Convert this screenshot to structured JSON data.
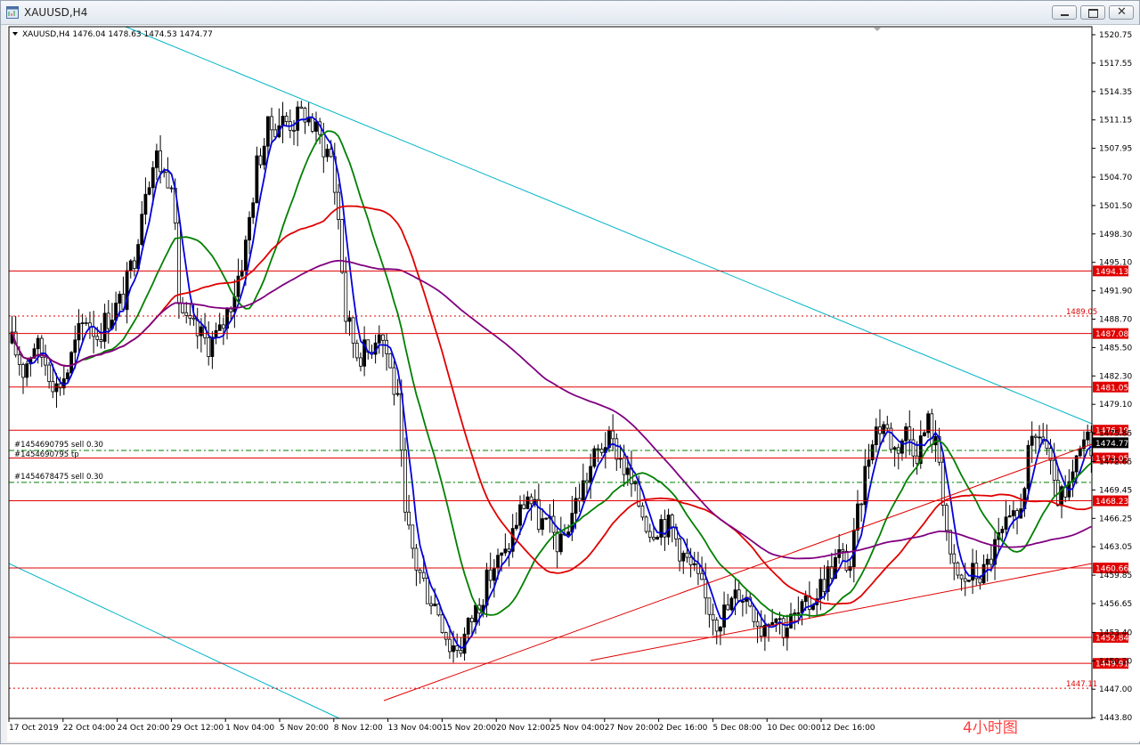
{
  "window": {
    "title": "XAUUSD,H4",
    "icon": "chart-window-icon",
    "buttons": [
      "minimize-icon",
      "restore-icon",
      "close-icon"
    ]
  },
  "chart_header": "XAUUSD,H4  1476.04 1478.63 1474.53 1474.77",
  "watermark": "4小时图",
  "price_axis": [
    "1520.75",
    "1517.55",
    "1514.35",
    "1511.15",
    "1507.95",
    "1504.70",
    "1501.50",
    "1498.30",
    "1495.10",
    "1491.90",
    "1488.70",
    "1485.50",
    "1482.30",
    "1479.10",
    "1475.85",
    "1472.65",
    "1469.45",
    "1466.25",
    "1463.05",
    "1459.85",
    "1456.65",
    "1453.40",
    "1450.20",
    "1447.00",
    "1443.80"
  ],
  "time_axis": [
    "17 Oct 2019",
    "22 Oct 04:00",
    "24 Oct 20:00",
    "29 Oct 12:00",
    "1 Nov 04:00",
    "5 Nov 20:00",
    "8 Nov 12:00",
    "13 Nov 04:00",
    "15 Nov 20:00",
    "20 Nov 12:00",
    "25 Nov 04:00",
    "27 Nov 20:00",
    "2 Dec 16:00",
    "5 Dec 08:00",
    "10 Dec 00:00",
    "12 Dec 16:00"
  ],
  "price_levels": [
    {
      "label": "1494.13",
      "style": "solid-box"
    },
    {
      "label": "1489.05",
      "style": "dotted-text"
    },
    {
      "label": "1487.08",
      "style": "solid-box"
    },
    {
      "label": "1481.05",
      "style": "solid-box"
    },
    {
      "label": "1476.19",
      "style": "solid-box"
    },
    {
      "label": "1473.05",
      "style": "solid-box"
    },
    {
      "label": "1468.23",
      "style": "solid-box"
    },
    {
      "label": "1460.66",
      "style": "solid-box"
    },
    {
      "label": "1452.84",
      "style": "solid-box"
    },
    {
      "label": "1449.91",
      "style": "solid-box"
    },
    {
      "label": "1447.11",
      "style": "dotted-text"
    }
  ],
  "current_price": "1474.77",
  "orders": [
    {
      "label": "#1454690795 sell 0.30"
    },
    {
      "label": "#1454690795 tp"
    },
    {
      "label": "#1454678475 sell 0.30"
    }
  ],
  "colors": {
    "up_candle": "#000000",
    "down_candle": "#ffffff",
    "ma_blue": "#0000dd",
    "ma_green": "#008000",
    "ma_red": "#e00000",
    "ma_purple": "#800080",
    "trendline_cyan": "#00b4c8",
    "level_red": "#e00000",
    "order_green": "#008000"
  },
  "chart_data": {
    "type": "candlestick",
    "symbol": "XAUUSD",
    "timeframe": "H4",
    "ylim": [
      1443.8,
      1522.0
    ],
    "anchors": [
      [
        0,
        1486
      ],
      [
        3,
        1483
      ],
      [
        6,
        1486
      ],
      [
        9,
        1484
      ],
      [
        12,
        1481
      ],
      [
        15,
        1483
      ],
      [
        18,
        1487
      ],
      [
        20,
        1489
      ],
      [
        23,
        1487
      ],
      [
        26,
        1489
      ],
      [
        30,
        1491
      ],
      [
        33,
        1496
      ],
      [
        36,
        1504
      ],
      [
        39,
        1507
      ],
      [
        41,
        1505
      ],
      [
        43,
        1505
      ],
      [
        45,
        1491
      ],
      [
        47,
        1488
      ],
      [
        50,
        1487
      ],
      [
        53,
        1486
      ],
      [
        56,
        1487
      ],
      [
        60,
        1492
      ],
      [
        63,
        1497
      ],
      [
        66,
        1506
      ],
      [
        69,
        1510
      ],
      [
        72,
        1511
      ],
      [
        76,
        1511
      ],
      [
        79,
        1512
      ],
      [
        83,
        1509
      ],
      [
        86,
        1507
      ],
      [
        88,
        1500
      ],
      [
        90,
        1489
      ],
      [
        93,
        1485
      ],
      [
        96,
        1485
      ],
      [
        99,
        1488
      ],
      [
        101,
        1485
      ],
      [
        104,
        1479
      ],
      [
        106,
        1466
      ],
      [
        109,
        1461
      ],
      [
        112,
        1458
      ],
      [
        115,
        1456
      ],
      [
        118,
        1452
      ],
      [
        121,
        1452
      ],
      [
        124,
        1455
      ],
      [
        127,
        1458
      ],
      [
        130,
        1461
      ],
      [
        133,
        1462
      ],
      [
        136,
        1466
      ],
      [
        139,
        1469
      ],
      [
        142,
        1466
      ],
      [
        145,
        1465
      ],
      [
        148,
        1463
      ],
      [
        151,
        1467
      ],
      [
        154,
        1470
      ],
      [
        157,
        1473
      ],
      [
        160,
        1475
      ],
      [
        163,
        1474
      ],
      [
        166,
        1471
      ],
      [
        169,
        1468
      ],
      [
        172,
        1465
      ],
      [
        175,
        1466
      ],
      [
        178,
        1465
      ],
      [
        181,
        1462
      ],
      [
        184,
        1460
      ],
      [
        187,
        1457
      ],
      [
        190,
        1455
      ],
      [
        193,
        1456
      ],
      [
        196,
        1458
      ],
      [
        199,
        1457
      ],
      [
        202,
        1454
      ],
      [
        205,
        1456
      ],
      [
        208,
        1454
      ],
      [
        211,
        1455
      ],
      [
        214,
        1456
      ],
      [
        217,
        1458
      ],
      [
        220,
        1460
      ],
      [
        223,
        1462
      ],
      [
        226,
        1461
      ],
      [
        229,
        1469
      ],
      [
        232,
        1476
      ],
      [
        235,
        1477
      ],
      [
        238,
        1474
      ],
      [
        241,
        1476
      ],
      [
        244,
        1474
      ],
      [
        247,
        1477
      ],
      [
        250,
        1473
      ],
      [
        253,
        1461
      ],
      [
        256,
        1459
      ],
      [
        259,
        1460
      ],
      [
        262,
        1460
      ],
      [
        265,
        1463
      ],
      [
        268,
        1465
      ],
      [
        271,
        1466
      ],
      [
        274,
        1473
      ],
      [
        277,
        1476
      ],
      [
        279,
        1474
      ],
      [
        281,
        1469
      ],
      [
        284,
        1468
      ],
      [
        287,
        1472
      ],
      [
        289,
        1475
      ],
      [
        291,
        1474.8
      ]
    ],
    "series": [
      {
        "name": "",
        "color": "#0000dd"
      },
      {
        "name": "",
        "color": "#008000"
      },
      {
        "name": "",
        "color": "#e00000"
      },
      {
        "name": "",
        "color": "#800080"
      }
    ]
  }
}
